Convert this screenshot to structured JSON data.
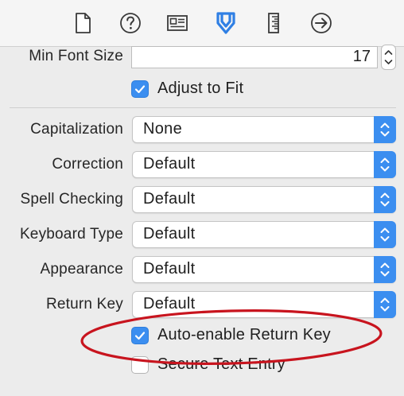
{
  "toolbar": {
    "icons": [
      "file-icon",
      "help-icon",
      "identity-icon",
      "attributes-icon",
      "size-icon",
      "connections-icon"
    ],
    "accent": "#2f7fe4"
  },
  "min_font_size": {
    "label": "Min Font Size",
    "value": "17"
  },
  "adjust_to_fit": {
    "label": "Adjust to Fit",
    "checked": true
  },
  "fields": [
    {
      "label": "Capitalization",
      "value": "None"
    },
    {
      "label": "Correction",
      "value": "Default"
    },
    {
      "label": "Spell Checking",
      "value": "Default"
    },
    {
      "label": "Keyboard Type",
      "value": "Default"
    },
    {
      "label": "Appearance",
      "value": "Default"
    },
    {
      "label": "Return Key",
      "value": "Default"
    }
  ],
  "auto_enable_return_key": {
    "label": "Auto-enable Return Key",
    "checked": true
  },
  "secure_text_entry": {
    "label": "Secure Text Entry",
    "checked": false
  },
  "annotation_color": "#c8141e"
}
